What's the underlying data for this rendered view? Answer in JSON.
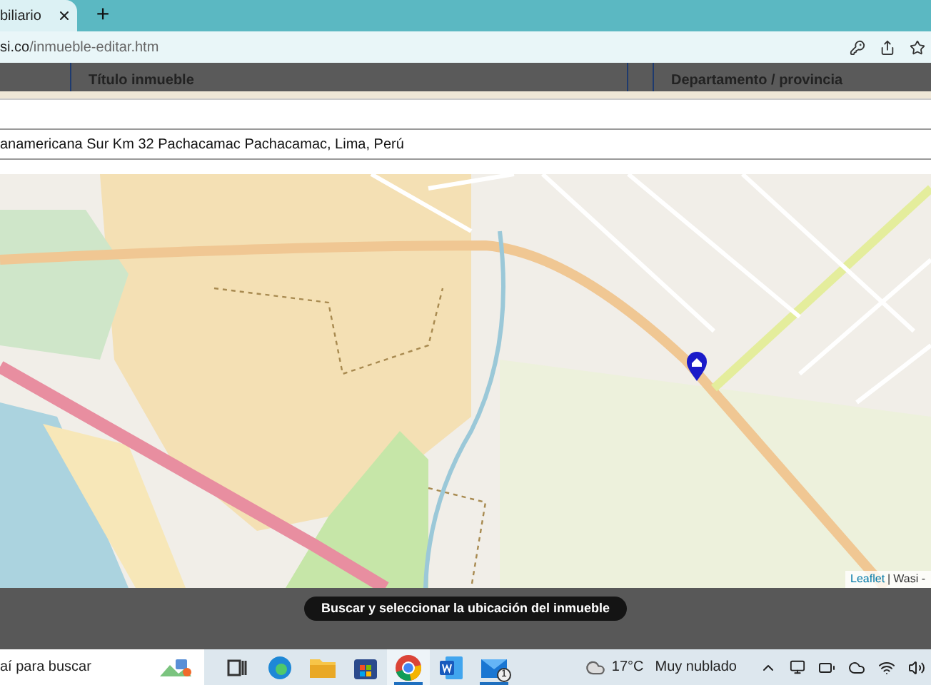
{
  "browser": {
    "tab": {
      "title": "biliario",
      "selected": true
    },
    "new_tab": "+",
    "url": {
      "host": "si.co",
      "path": "/inmueble-editar.htm"
    }
  },
  "form": {
    "columns": [
      "Título inmueble",
      "Departamento / provincia"
    ],
    "address": {
      "value": "anamericana Sur Km 32 Pachacamac Pachacamac, Lima, Perú"
    }
  },
  "map": {
    "attribution": {
      "link": "Leaflet",
      "separator": "|",
      "source": "Wasi -"
    }
  },
  "action_button": "Buscar y seleccionar la ubicación del inmueble",
  "taskbar": {
    "search_placeholder": "aí para buscar",
    "apps": [
      {
        "kind": "task-view",
        "selected": false,
        "running": false
      },
      {
        "kind": "edge",
        "selected": false,
        "running": false
      },
      {
        "kind": "explorer",
        "selected": false,
        "running": false
      },
      {
        "kind": "store",
        "selected": false,
        "running": false
      },
      {
        "kind": "chrome",
        "selected": true,
        "running": true
      },
      {
        "kind": "word",
        "selected": false,
        "running": false
      },
      {
        "kind": "mail",
        "selected": false,
        "running": true,
        "badge": "1"
      }
    ],
    "weather": {
      "temperature": "17°C",
      "condition": "Muy nublado"
    }
  }
}
